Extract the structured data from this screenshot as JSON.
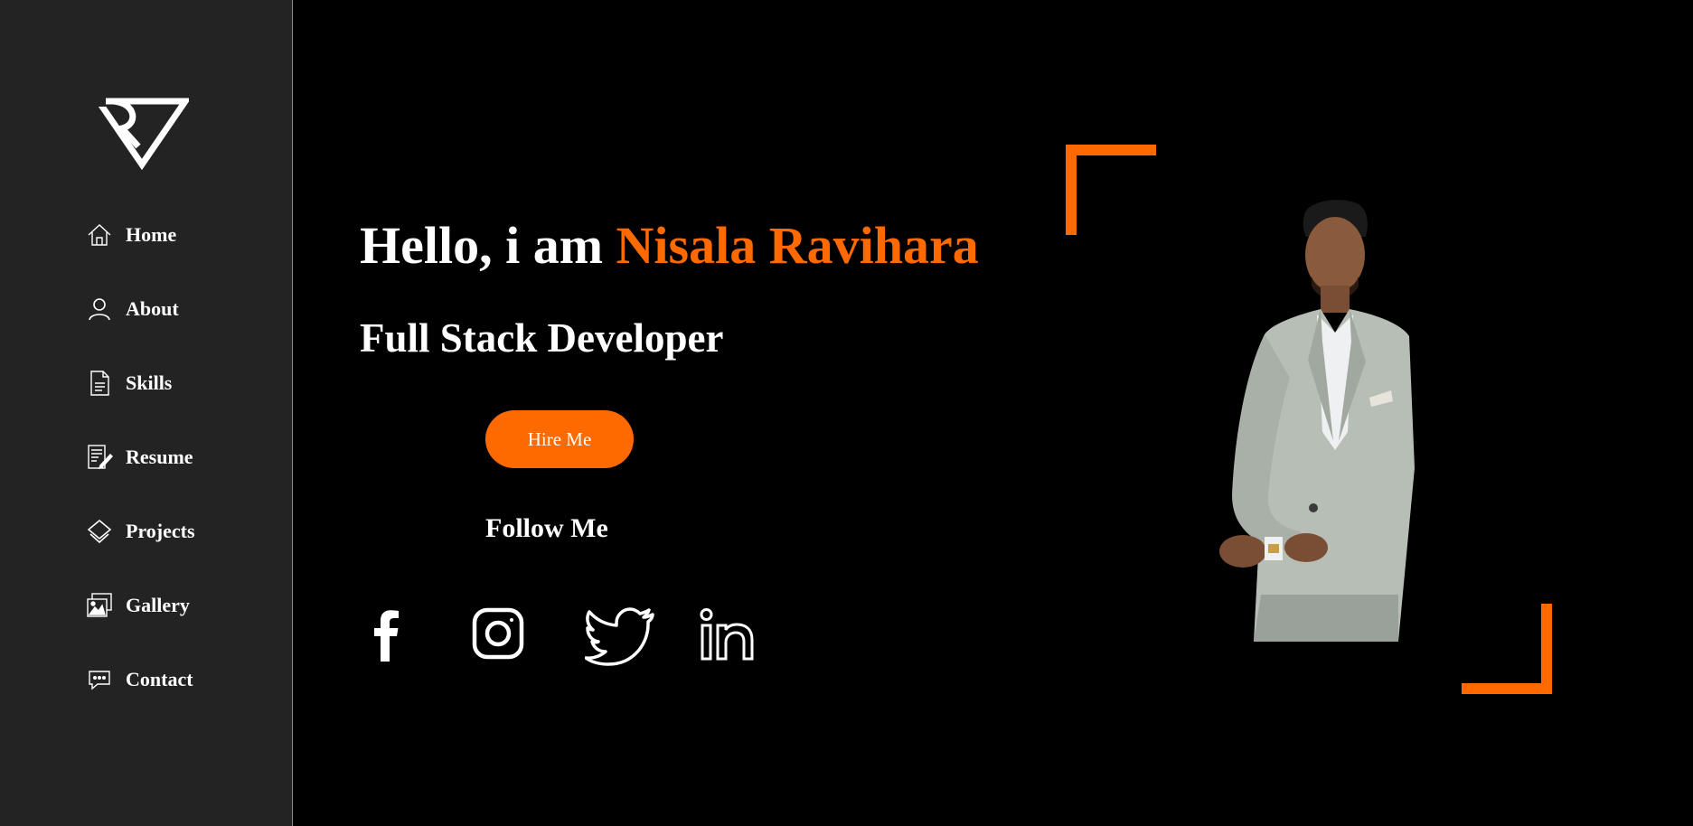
{
  "sidebar": {
    "logo_icon": "rv-monogram-logo",
    "items": [
      {
        "label": "Home",
        "icon": "home-icon"
      },
      {
        "label": "About",
        "icon": "user-icon"
      },
      {
        "label": "Skills",
        "icon": "document-icon"
      },
      {
        "label": "Resume",
        "icon": "resume-icon"
      },
      {
        "label": "Projects",
        "icon": "layers-icon"
      },
      {
        "label": "Gallery",
        "icon": "gallery-icon"
      },
      {
        "label": "Contact",
        "icon": "chat-icon"
      }
    ]
  },
  "hero": {
    "greeting_prefix": "Hello, i am ",
    "name": "Nisala Ravihara",
    "role": "Full Stack Developer",
    "hire_button": "Hire Me",
    "follow_heading": "Follow Me",
    "socials": [
      {
        "icon": "facebook-icon"
      },
      {
        "icon": "instagram-icon"
      },
      {
        "icon": "twitter-icon"
      },
      {
        "icon": "linkedin-icon"
      }
    ]
  },
  "colors": {
    "accent": "#ff6a00",
    "sidebar_bg": "#232323",
    "main_bg": "#000000",
    "text": "#ffffff"
  }
}
